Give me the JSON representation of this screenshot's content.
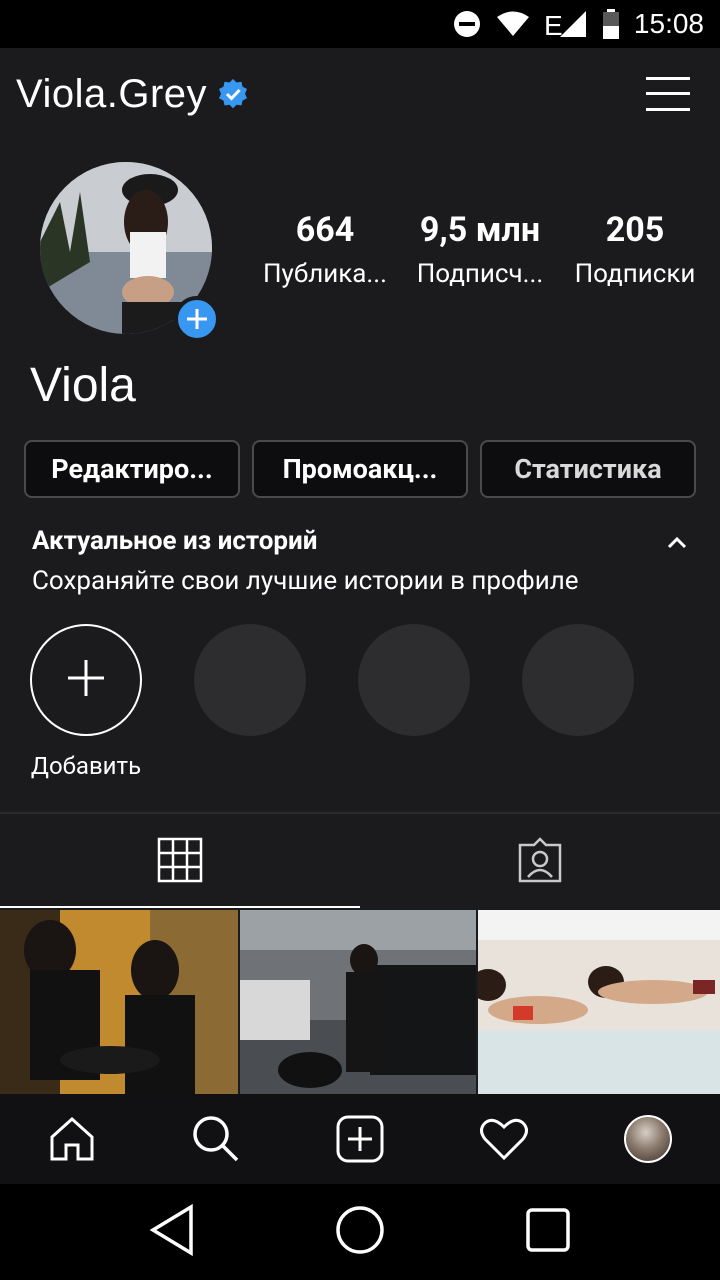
{
  "status_bar": {
    "time": "15:08",
    "icons": [
      "dnd-icon",
      "wifi-icon",
      "signal-e-icon",
      "battery-icon"
    ]
  },
  "header": {
    "username": "Viola.Grey",
    "verified": true,
    "menu_icon": "hamburger-menu-icon"
  },
  "profile": {
    "display_name": "Viola",
    "stats": [
      {
        "value": "664",
        "label": "Публика..."
      },
      {
        "value": "9,5 млн",
        "label": "Подписч..."
      },
      {
        "value": "205",
        "label": "Подписки"
      }
    ]
  },
  "actions": {
    "edit": "Редактиро...",
    "promo": "Промоакц...",
    "stats": "Статистика"
  },
  "highlights": {
    "title": "Актуальное из историй",
    "subtitle": "Сохраняйте свои лучшие истории в профиле",
    "add_label": "Добавить"
  },
  "tabs": {
    "grid_icon": "grid-icon",
    "tagged_icon": "tagged-person-icon",
    "active": "grid"
  },
  "bottom_nav": [
    "home-icon",
    "search-icon",
    "add-post-icon",
    "heart-icon",
    "profile-avatar"
  ],
  "system_nav": [
    "back-icon",
    "home-circle-icon",
    "recents-square-icon"
  ],
  "colors": {
    "background": "#1b1b1d",
    "accent_blue": "#3897f0",
    "button_border": "#4a4a4e"
  }
}
